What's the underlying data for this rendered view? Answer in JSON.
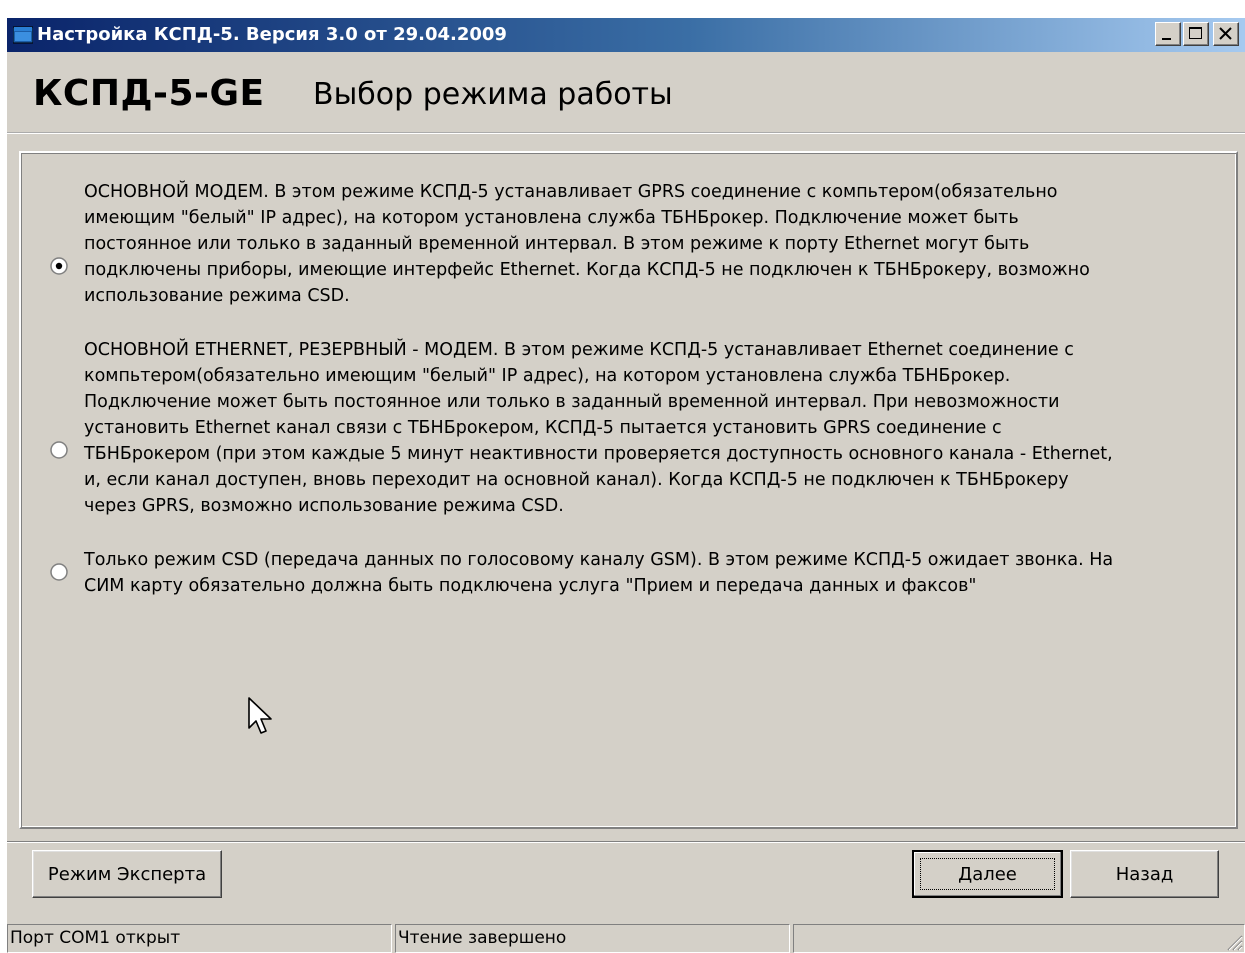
{
  "window": {
    "title": "Настройка КСПД-5. Версия 3.0 от 29.04.2009",
    "icon": "app-window-icon",
    "controls": [
      "minimize-icon",
      "maximize-icon",
      "close-icon"
    ]
  },
  "header": {
    "product": "КСПД-5-GE",
    "subtitle": "Выбор режима работы"
  },
  "options": [
    {
      "checked": true,
      "text": "ОСНОВНОЙ МОДЕМ. В этом режиме КСПД-5 устанавливает GPRS соединение с компьтером(обязательно\nимеющим \"белый\" IP адрес), на котором установлена служба ТБНБрокер. Подключение может быть\nпостоянное или только в заданный временной интервал. В этом режиме к порту Ethernet могут быть\nподключены приборы, имеющие интерфейс Ethernet. Когда КСПД-5 не подключен к ТБНБрокеру, возможно\nиспользование режима CSD."
    },
    {
      "checked": false,
      "text": "ОСНОВНОЙ ETHERNET, РЕЗЕРВНЫЙ - МОДЕМ. В этом режиме КСПД-5 устанавливает Ethernet соединение с\nкомпьтером(обязательно имеющим \"белый\" IP адрес), на котором установлена служба ТБНБрокер.\nПодключение может быть постоянное или только в заданный временной интервал. При невозможности\nустановить Ethernet канал связи с ТБНБрокером, КСПД-5 пытается установить GPRS соединение с\nТБНБрокером (при этом каждые 5 минут неактивности проверяется доступность основного канала - Ethernet,\nи, если канал доступен, вновь переходит на основной канал). Когда КСПД-5 не подключен к ТБНБрокеру\nчерез GPRS, возможно использование режима CSD."
    },
    {
      "checked": false,
      "text": "Только режим CSD (передача данных по голосовому каналу GSM). В этом режиме КСПД-5 ожидает звонка. На\nСИМ карту обязательно должна быть подключена услуга \"Прием и передача данных и факсов\""
    }
  ],
  "buttons": {
    "expert": "Режим Эксперта",
    "next": "Далее",
    "back": "Назад"
  },
  "status": {
    "port": "Порт COM1 открыт",
    "reading": "Чтение завершено",
    "extra": ""
  }
}
